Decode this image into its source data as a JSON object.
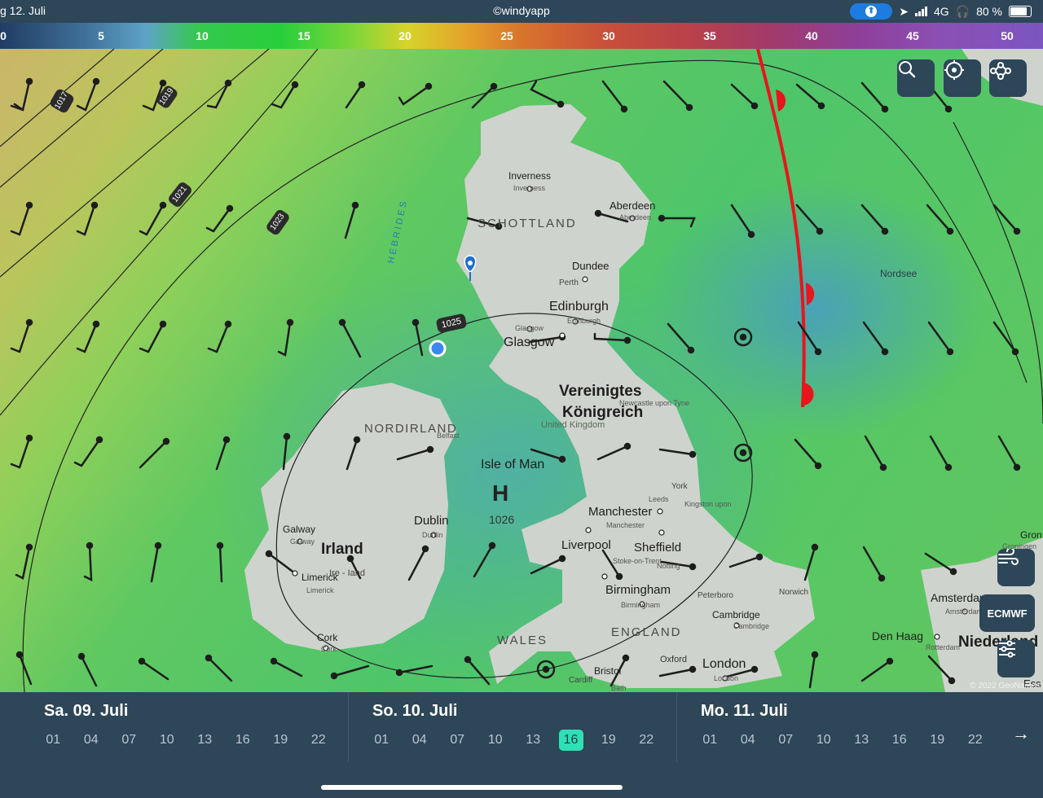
{
  "status_bar": {
    "date_fragment": "g 12. Juli",
    "app_credit": "©windyapp",
    "network": "4G",
    "battery": "80 %"
  },
  "color_scale": {
    "ticks": [
      "0",
      "5",
      "10",
      "15",
      "20",
      "25",
      "30",
      "35",
      "40",
      "45",
      "50"
    ]
  },
  "map": {
    "labels": {
      "inverness": "Inverness",
      "inverness_sub": "Inverness",
      "aberdeen": "Aberdeen",
      "aberdeen_sub": "Aberdeen",
      "scotland": "SCHOTTLAND",
      "hebrides": "HEBRIDES",
      "dundee": "Dundee",
      "perth": "Perth",
      "edinburgh": "Edinburgh",
      "edinburgh_sub": "Edinburgh",
      "glasgow": "Glasgow",
      "glasgow_sub": "Glasgow",
      "nordsee": "Nordsee",
      "uk_de1": "Vereinigtes",
      "uk_de2": "Königreich",
      "uk_en": "United Kingdom",
      "newcastle": "Newcastle upon Tyne",
      "nordirland": "NORDIRLAND",
      "belfast": "Belfast",
      "isle_of_man": "Isle of Man",
      "h_marker": "H",
      "pressure_center": "1026",
      "york": "York",
      "leeds": "Leeds",
      "kingston": "Kingston upon",
      "manchester": "Manchester",
      "manchester_sub": "Manchester",
      "dublin": "Dublin",
      "dublin_sub": "Dublin",
      "galway": "Galway",
      "galway_sub": "Galway",
      "irland": "Irland",
      "ireland_en": "Ire - Iand",
      "limerick": "Limerick",
      "limerick_sub": "Limerick",
      "liverpool": "Liverpool",
      "sheffield": "Sheffield",
      "stoke": "Stoke-on-Trent",
      "nottingham": "Notting",
      "birmingham": "Birmingham",
      "birmingham_sub": "Birmingham",
      "peterborough": "Peterboro",
      "norwich": "Norwich",
      "cambridge": "Cambridge",
      "cambridge_sub": "Cambridge",
      "cork": "Cork",
      "cork_sub": "Cork",
      "wales": "WALES",
      "england": "ENGLAND",
      "amsterdam": "Amsterdam",
      "amsterdam_sub": "Amsterdam",
      "den_haag": "Den Haag",
      "rotterdam": "Rotterdam",
      "niederlande": "Niederland",
      "oxford": "Oxford",
      "london": "London",
      "london_sub": "London",
      "bristol": "Bristol",
      "cardiff": "Cardiff",
      "bath": "Bath",
      "groningen": "Gron",
      "groningen_sub": "Groningen",
      "ess": "Ess"
    },
    "isobars": [
      "1017",
      "1019",
      "1021",
      "1023",
      "1025"
    ],
    "copyright": "© 2022 GeoNames"
  },
  "controls": {
    "search_icon": "search-icon",
    "locate_icon": "crosshair-icon",
    "route_icon": "route-icon",
    "wind_icon": "wind-icon",
    "model_label": "ECMWF",
    "settings_icon": "sliders-icon"
  },
  "timeline": {
    "days": [
      {
        "label": "Sa. 09. Juli",
        "hours": [
          "01",
          "04",
          "07",
          "10",
          "13",
          "16",
          "19",
          "22"
        ]
      },
      {
        "label": "So. 10. Juli",
        "hours": [
          "01",
          "04",
          "07",
          "10",
          "13",
          "16",
          "19",
          "22"
        ]
      },
      {
        "label": "Mo. 11. Juli",
        "hours": [
          "01",
          "04",
          "07",
          "10",
          "13",
          "16",
          "19",
          "22"
        ]
      }
    ],
    "selected": {
      "day": 1,
      "hour": "16"
    }
  },
  "colors": {
    "ui_dark": "#2d4658",
    "selected_hour": "#2fe0b4",
    "front_line": "#e8151c",
    "location_pin": "#1e6fd0"
  }
}
